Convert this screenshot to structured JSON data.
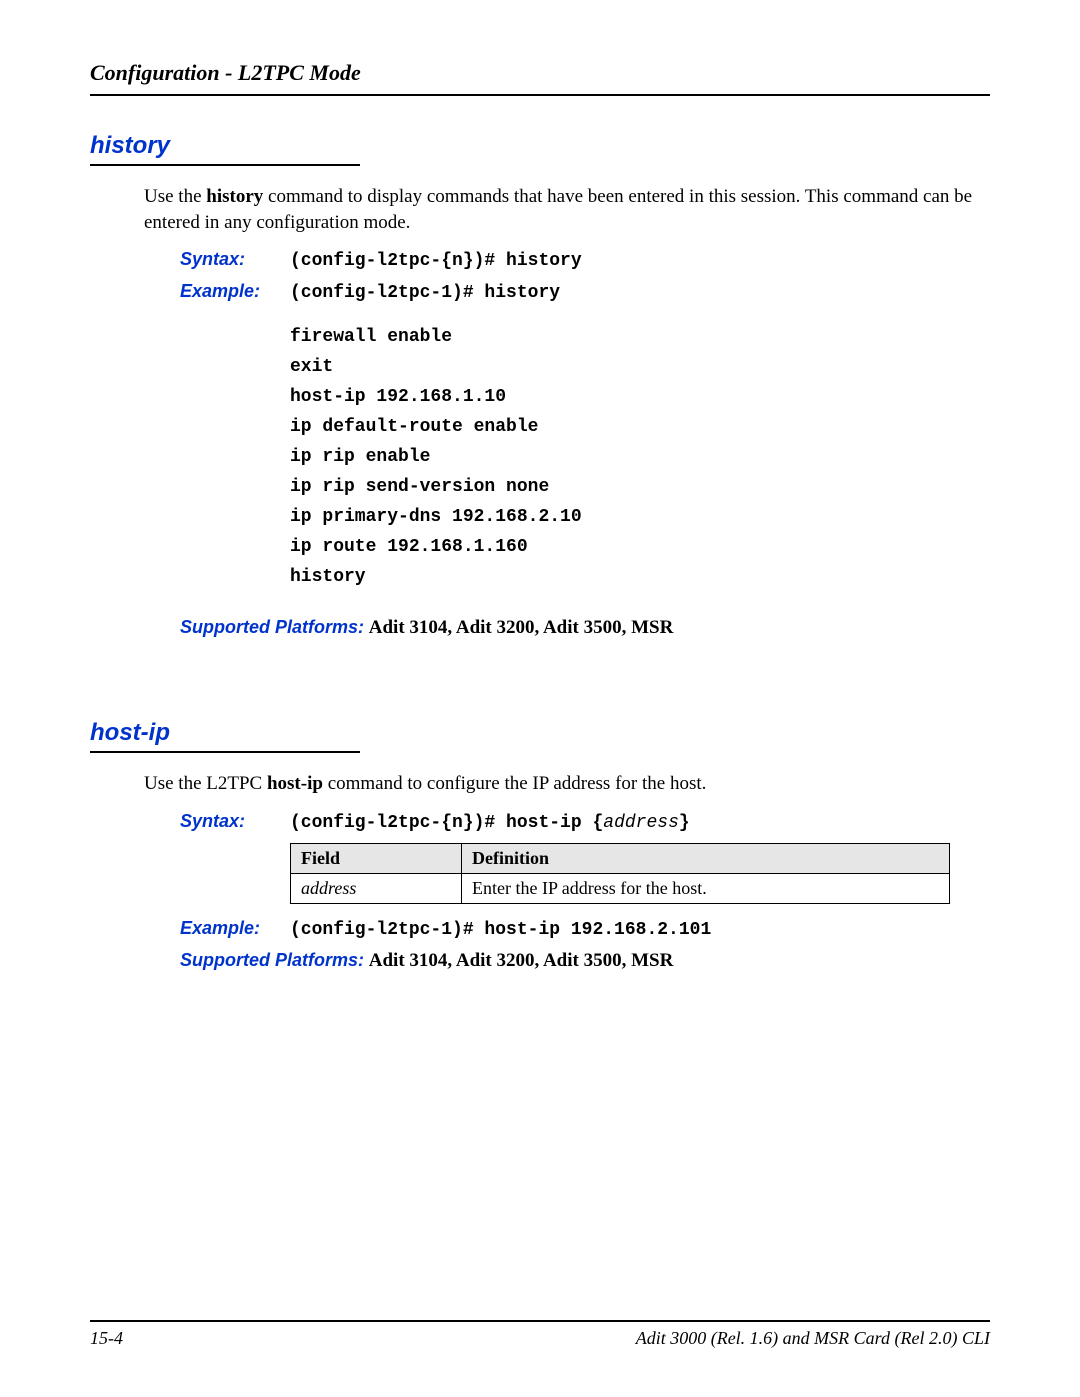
{
  "header": {
    "title": "Configuration - L2TPC Mode"
  },
  "section1": {
    "title": "history",
    "para_pre": "Use the ",
    "para_bold": "history",
    "para_post": " command to display commands that have been entered in this session. This command can be entered in any configuration mode.",
    "syntax_label": "Syntax:",
    "syntax_value": "(config-l2tpc-{n})# history",
    "example_label": "Example:",
    "example_value": "(config-l2tpc-1)# history",
    "output_lines": [
      "firewall enable",
      "exit",
      "host-ip 192.168.1.10",
      "ip default-route enable",
      "ip rip enable",
      "ip rip send-version none",
      "ip primary-dns 192.168.2.10",
      "ip route 192.168.1.160",
      "history"
    ],
    "platforms_label": "Supported Platforms:",
    "platforms_value": " Adit 3104, Adit 3200, Adit 3500, MSR"
  },
  "section2": {
    "title": "host-ip",
    "para_pre": "Use the L2TPC ",
    "para_bold": "host-ip",
    "para_post": " command to configure the IP address for the host.",
    "syntax_label": "Syntax:",
    "syntax_prefix": "(config-l2tpc-{n})# host-ip {",
    "syntax_arg": "address",
    "syntax_suffix": "}",
    "table": {
      "head_field": "Field",
      "head_def": "Definition",
      "row_field": "address",
      "row_def": "Enter the IP address for the host."
    },
    "example_label": "Example:",
    "example_value": "(config-l2tpc-1)# host-ip 192.168.2.101",
    "platforms_label": "Supported Platforms:",
    "platforms_value": " Adit 3104, Adit 3200, Adit 3500, MSR"
  },
  "footer": {
    "left": "15-4",
    "right": "Adit 3000 (Rel. 1.6) and MSR Card (Rel 2.0) CLI"
  }
}
